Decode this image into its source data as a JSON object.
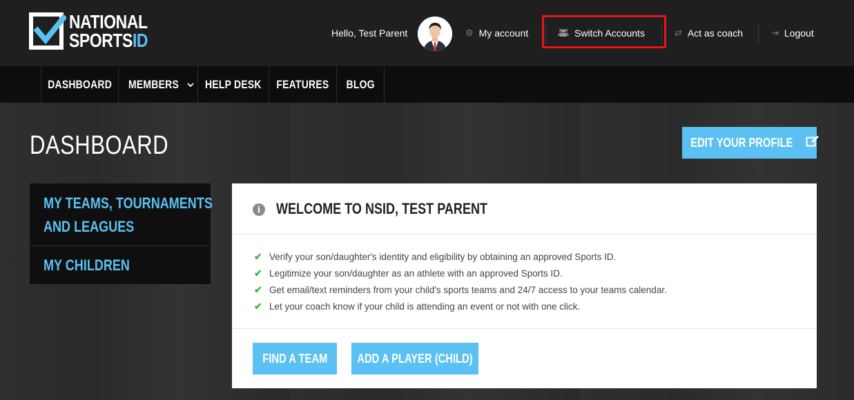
{
  "brand": {
    "line1": "NATIONAL",
    "line2_main": "SPORTS",
    "line2_accent": "ID",
    "accent_color": "#5bc0f2"
  },
  "header": {
    "greeting": "Hello, Test Parent",
    "my_account": "My account",
    "switch_accounts": "Switch Accounts",
    "act_as_coach": "Act as coach",
    "logout": "Logout",
    "highlight_color": "#e8141b"
  },
  "nav": {
    "items": [
      {
        "label": "DASHBOARD"
      },
      {
        "label": "MEMBERS",
        "has_dropdown": true
      },
      {
        "label": "HELP DESK"
      },
      {
        "label": "FEATURES"
      },
      {
        "label": "BLOG"
      }
    ]
  },
  "page": {
    "title": "DASHBOARD",
    "edit_profile": "EDIT YOUR PROFILE"
  },
  "sidebar": {
    "items": [
      {
        "line1": "MY TEAMS, TOURNAMENTS",
        "line2": "AND LEAGUES"
      },
      {
        "line1": "MY CHILDREN"
      }
    ]
  },
  "panel": {
    "title": "WELCOME TO NSID, TEST PARENT",
    "bullets": [
      "Verify your son/daughter's identity and eligibility by obtaining an approved Sports ID.",
      "Legitimize your son/daughter as an athlete with an approved Sports ID.",
      "Get email/text reminders from your child's sports teams and 24/7 access to your teams calendar.",
      "Let your coach know if your child is attending an event or not with one click."
    ],
    "find_team": "FIND A TEAM",
    "add_player": "ADD A PLAYER (CHILD)",
    "check_color": "#3eb24a"
  }
}
